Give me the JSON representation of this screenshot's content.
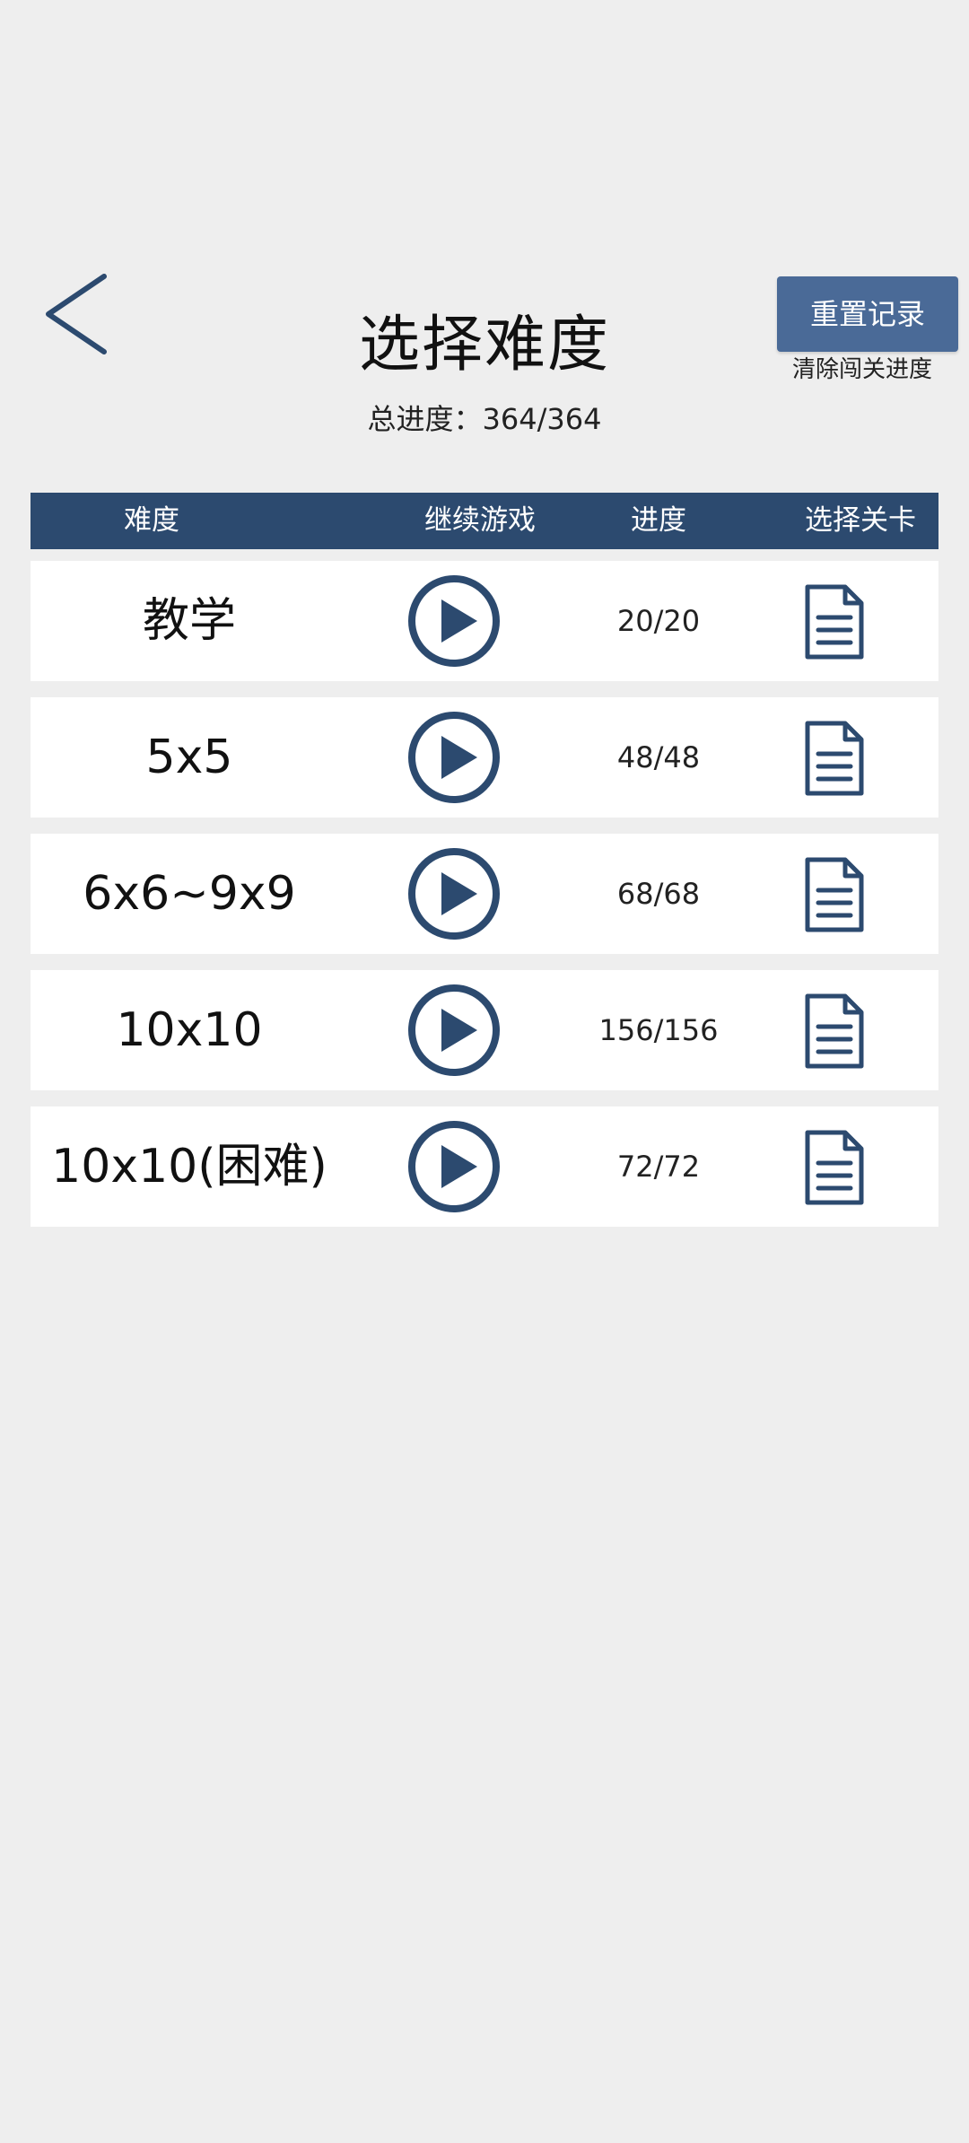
{
  "header": {
    "title": "选择难度",
    "total_progress": "总进度：364/364",
    "reset_label": "重置记录",
    "reset_hint": "清除闯关进度"
  },
  "table": {
    "columns": [
      "难度",
      "继续游戏",
      "进度",
      "选择关卡"
    ],
    "rows": [
      {
        "name": "教学",
        "progress": "20/20"
      },
      {
        "name": "5x5",
        "progress": "48/48"
      },
      {
        "name": "6x6~9x9",
        "progress": "68/68"
      },
      {
        "name": "10x10",
        "progress": "156/156"
      },
      {
        "name": "10x10(困难)",
        "progress": "72/72"
      }
    ]
  },
  "icons": {
    "back": "chevron-left-icon",
    "play": "play-circle-icon",
    "levels": "document-icon"
  },
  "colors": {
    "background": "#eeeeee",
    "header_bar": "#2c4a6f",
    "reset_button": "#4a6a97",
    "icon": "#2c4a6f",
    "row_background": "#ffffff"
  }
}
